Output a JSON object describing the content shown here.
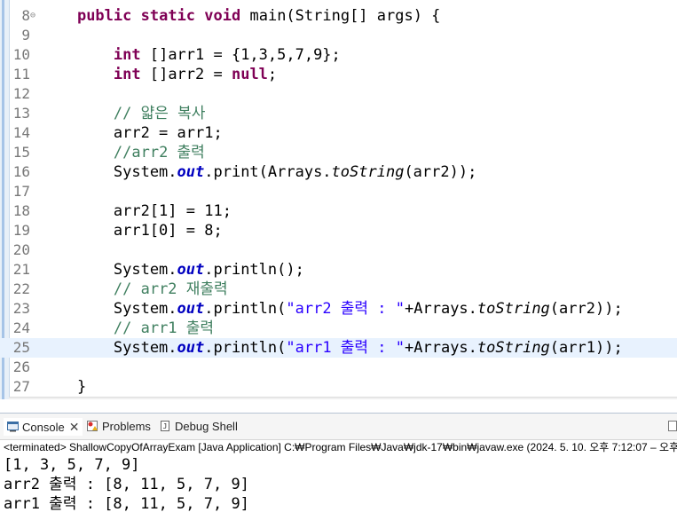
{
  "editor": {
    "lines": [
      {
        "n": "8",
        "fold": "⊖",
        "tokens": [
          [
            "plain",
            "    "
          ],
          [
            "kw",
            "public"
          ],
          [
            "plain",
            " "
          ],
          [
            "kw",
            "static"
          ],
          [
            "plain",
            " "
          ],
          [
            "kw",
            "void"
          ],
          [
            "plain",
            " main(String[] args) {"
          ]
        ]
      },
      {
        "n": "9",
        "tokens": []
      },
      {
        "n": "10",
        "tokens": [
          [
            "plain",
            "        "
          ],
          [
            "kw",
            "int"
          ],
          [
            "plain",
            " []arr1 = {1,3,5,7,9};"
          ]
        ]
      },
      {
        "n": "11",
        "tokens": [
          [
            "plain",
            "        "
          ],
          [
            "kw",
            "int"
          ],
          [
            "plain",
            " []arr2 = "
          ],
          [
            "kw",
            "null"
          ],
          [
            "plain",
            ";"
          ]
        ]
      },
      {
        "n": "12",
        "tokens": []
      },
      {
        "n": "13",
        "tokens": [
          [
            "plain",
            "        "
          ],
          [
            "cm",
            "// 얇은 복사"
          ]
        ]
      },
      {
        "n": "14",
        "tokens": [
          [
            "plain",
            "        arr2 = arr1;"
          ]
        ]
      },
      {
        "n": "15",
        "tokens": [
          [
            "plain",
            "        "
          ],
          [
            "cm",
            "//arr2 출력"
          ]
        ]
      },
      {
        "n": "16",
        "tokens": [
          [
            "plain",
            "        System."
          ],
          [
            "fld",
            "out"
          ],
          [
            "plain",
            ".print(Arrays."
          ],
          [
            "st",
            "toString"
          ],
          [
            "plain",
            "(arr2));"
          ]
        ]
      },
      {
        "n": "17",
        "tokens": []
      },
      {
        "n": "18",
        "tokens": [
          [
            "plain",
            "        arr2[1] = 11;"
          ]
        ]
      },
      {
        "n": "19",
        "tokens": [
          [
            "plain",
            "        arr1[0] = 8;"
          ]
        ]
      },
      {
        "n": "20",
        "tokens": []
      },
      {
        "n": "21",
        "tokens": [
          [
            "plain",
            "        System."
          ],
          [
            "fld",
            "out"
          ],
          [
            "plain",
            ".println();"
          ]
        ]
      },
      {
        "n": "22",
        "tokens": [
          [
            "plain",
            "        "
          ],
          [
            "cm",
            "// arr2 재출력"
          ]
        ]
      },
      {
        "n": "23",
        "tokens": [
          [
            "plain",
            "        System."
          ],
          [
            "fld",
            "out"
          ],
          [
            "plain",
            ".println("
          ],
          [
            "str",
            "\"arr2 출력 : \""
          ],
          [
            "plain",
            "+Arrays."
          ],
          [
            "st",
            "toString"
          ],
          [
            "plain",
            "(arr2));"
          ]
        ]
      },
      {
        "n": "24",
        "tokens": [
          [
            "plain",
            "        "
          ],
          [
            "cm",
            "// arr1 출력"
          ]
        ]
      },
      {
        "n": "25",
        "current": true,
        "tokens": [
          [
            "plain",
            "        System."
          ],
          [
            "fld",
            "out"
          ],
          [
            "plain",
            ".println("
          ],
          [
            "str",
            "\"arr1 출력 : \""
          ],
          [
            "plain",
            "+Arrays."
          ],
          [
            "st",
            "toString"
          ],
          [
            "plain",
            "(arr1));"
          ]
        ]
      },
      {
        "n": "26",
        "tokens": []
      },
      {
        "n": "27",
        "tokens": [
          [
            "plain",
            "    }"
          ]
        ]
      }
    ],
    "scroll_arrow": "<"
  },
  "console": {
    "tabs": [
      {
        "label": "Console",
        "icon": "console-icon",
        "active": true,
        "close": "✕"
      },
      {
        "label": "Problems",
        "icon": "problems-icon"
      },
      {
        "label": "Debug Shell",
        "icon": "debug-shell-icon"
      }
    ],
    "status": "<terminated> ShallowCopyOfArrayExam [Java Application] C:₩Program Files₩Java₩jdk-17₩bin₩javaw.exe  (2024. 5. 10. 오후 7:12:07 – 오후",
    "output": [
      "[1, 3, 5, 7, 9]",
      "arr2 출력 : [8, 11, 5, 7, 9]",
      "arr1 출력 : [8, 11, 5, 7, 9]"
    ]
  },
  "colors": {
    "keyword": "#7f0055",
    "comment": "#3f7f5f",
    "string": "#2a00ff",
    "field": "#0000c0",
    "current_line": "#e8f2fe"
  }
}
